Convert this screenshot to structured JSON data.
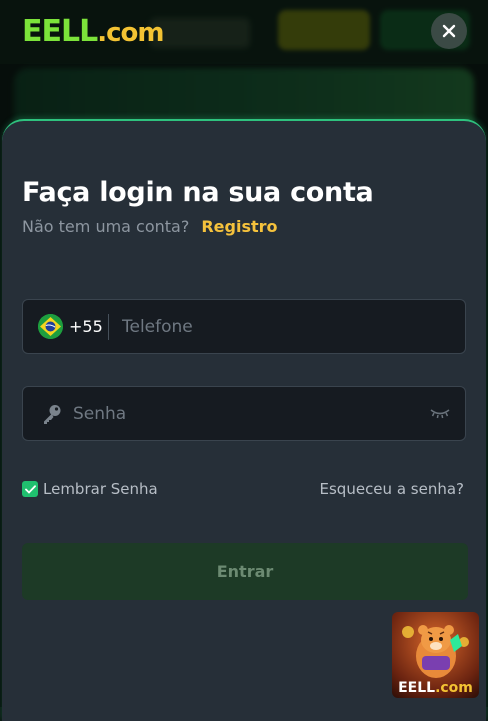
{
  "brand": {
    "logo_main": "EELL",
    "logo_suffix": ".com"
  },
  "colors": {
    "accent": "#2ec27e",
    "link": "#f5c23c",
    "sheet_bg": "#262f38"
  },
  "login": {
    "title": "Faça login na sua conta",
    "no_account_text": "Não tem uma conta?",
    "register_link": "Registro",
    "phone": {
      "country": "Brazil",
      "flag_icon": "brazil-flag-icon",
      "prefix": "+55",
      "placeholder": "Telefone",
      "value": ""
    },
    "password": {
      "placeholder": "Senha",
      "value": ""
    },
    "remember_label": "Lembrar Senha",
    "remember_checked": true,
    "forgot_link": "Esqueceu a senha?",
    "submit_label": "Entrar"
  },
  "promo": {
    "label_main": "EELL",
    "label_suffix": ".com"
  }
}
